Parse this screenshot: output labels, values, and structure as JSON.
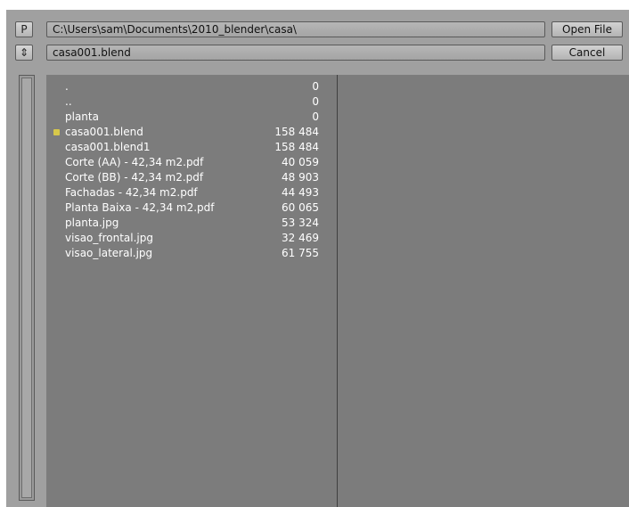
{
  "toolbar": {
    "parent_button_label": "P",
    "sort_icon_glyph": "⇕",
    "path_value": "C:\\Users\\sam\\Documents\\2010_blender\\casa\\",
    "filename_value": "casa001.blend",
    "open_file_label": "Open File",
    "cancel_label": "Cancel"
  },
  "files": [
    {
      "name": ".",
      "size": "0"
    },
    {
      "name": "..",
      "size": "0"
    },
    {
      "name": "planta",
      "size": "0"
    },
    {
      "name": "casa001.blend",
      "size": "158 484"
    },
    {
      "name": "casa001.blend1",
      "size": "158 484"
    },
    {
      "name": "Corte (AA) - 42,34 m2.pdf",
      "size": "40 059"
    },
    {
      "name": "Corte (BB) - 42,34 m2.pdf",
      "size": "48 903"
    },
    {
      "name": "Fachadas - 42,34 m2.pdf",
      "size": "44 493"
    },
    {
      "name": "Planta Baixa - 42,34 m2.pdf",
      "size": "60 065"
    },
    {
      "name": "planta.jpg",
      "size": "53 324"
    },
    {
      "name": "visao_frontal.jpg",
      "size": "32 469"
    },
    {
      "name": "visao_lateral.jpg",
      "size": "61 755"
    }
  ]
}
